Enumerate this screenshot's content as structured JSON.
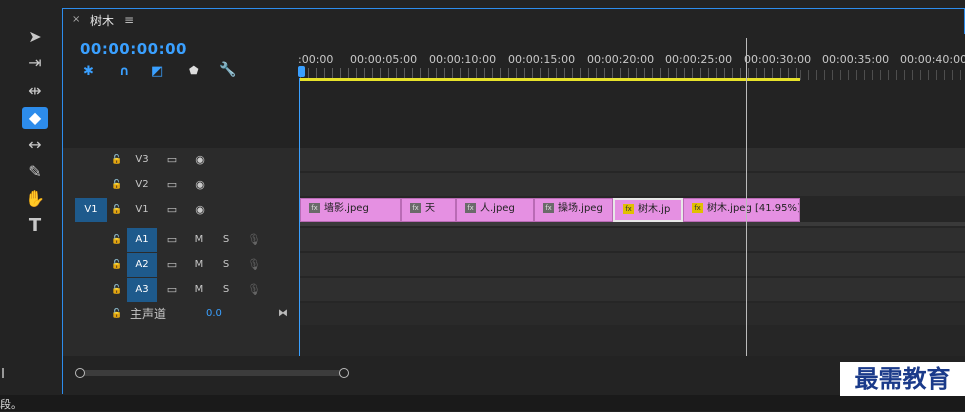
{
  "sequence_tab": {
    "close": "×",
    "title": "树木",
    "menu": "≡"
  },
  "timecode": "00:00:00:00",
  "ruler_labels": [
    ":00:00",
    "00:00:05:00",
    "00:00:10:00",
    "00:00:15:00",
    "00:00:20:00",
    "00:00:25:00",
    "00:00:30:00",
    "00:00:35:00",
    "00:00:40:00"
  ],
  "video_tracks": [
    {
      "name": "V3",
      "source": ""
    },
    {
      "name": "V2",
      "source": ""
    },
    {
      "name": "V1",
      "source": "V1"
    }
  ],
  "audio_tracks": [
    {
      "name": "A1",
      "m": "M",
      "s": "S"
    },
    {
      "name": "A2",
      "m": "M",
      "s": "S"
    },
    {
      "name": "A3",
      "m": "M",
      "s": "S"
    }
  ],
  "master": {
    "label": "主声道",
    "value": "0.0"
  },
  "clips": [
    {
      "name": "墙影.jpeg",
      "fx": "fx"
    },
    {
      "name": "天",
      "fx": "fx"
    },
    {
      "name": "人.jpeg",
      "fx": "fx"
    },
    {
      "name": "操场.jpeg",
      "fx": "fx"
    },
    {
      "name": "树木.jp",
      "fx": "fx"
    },
    {
      "name": "树木.jpeg [41.95%]",
      "fx": "fx"
    }
  ],
  "status_text": "段。",
  "watermark": "最需教育",
  "colors": {
    "accent": "#2d8ceb",
    "clip": "#e590e2",
    "work_area": "#e7e22a",
    "track_target": "#1e5a8c"
  },
  "icons": [
    "selection-tool-icon",
    "track-select-icon",
    "ripple-edit-icon",
    "razor-icon",
    "slip-icon",
    "pen-icon",
    "hand-icon",
    "type-icon"
  ]
}
